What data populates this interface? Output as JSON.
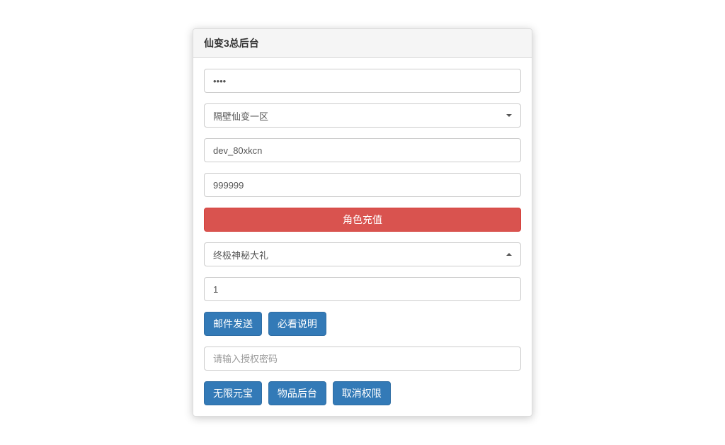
{
  "panel": {
    "title": "仙变3总后台"
  },
  "form": {
    "password_value": "••••",
    "server_select": "隔壁仙变一区",
    "account_value": "dev_80xkcn",
    "amount_value": "999999",
    "recharge_button": "角色充值",
    "gift_select": "终极神秘大礼",
    "quantity_value": "1",
    "mail_send_button": "邮件发送",
    "must_read_button": "必看说明",
    "auth_password_placeholder": "请输入授权密码",
    "unlimited_yuanbao_button": "无限元宝",
    "item_backend_button": "物品后台",
    "cancel_auth_button": "取消权限"
  }
}
